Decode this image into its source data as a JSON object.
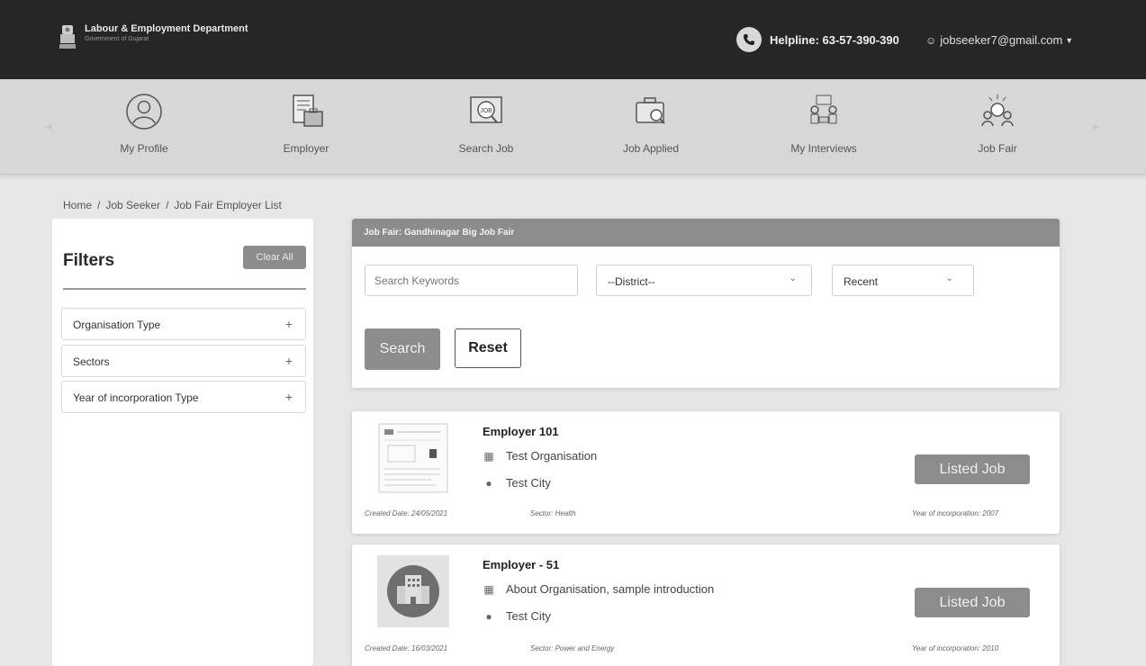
{
  "header": {
    "dept_name": "Labour & Employment Department",
    "dept_sub": "Government of Gujarat",
    "helpline": "Helpline: 63-57-390-390",
    "user_email": "jobseeker7@gmail.com"
  },
  "nav": {
    "items": [
      {
        "label": "My Profile",
        "icon": "profile-icon"
      },
      {
        "label": "Employer",
        "icon": "employer-icon"
      },
      {
        "label": "Search Job",
        "icon": "search-job-icon"
      },
      {
        "label": "Job Applied",
        "icon": "job-applied-icon"
      },
      {
        "label": "My Interviews",
        "icon": "interviews-icon"
      },
      {
        "label": "Job Fair",
        "icon": "job-fair-icon"
      }
    ]
  },
  "breadcrumb": [
    "Home",
    "Job Seeker",
    "Job Fair Employer List"
  ],
  "filters": {
    "title": "Filters",
    "clear_all": "Clear All",
    "items": [
      "Organisation Type",
      "Sectors",
      "Year of incorporation Type"
    ],
    "expand_symbol": "+"
  },
  "search": {
    "header": "Job Fair: Gandhinagar Big Job Fair",
    "keyword_placeholder": "Search Keywords",
    "district_value": "--District--",
    "sort_value": "Recent",
    "search_label": "Search",
    "reset_label": "Reset"
  },
  "employers": [
    {
      "name": "Employer 101",
      "organisation": "Test Organisation",
      "city": "Test City",
      "created": "Created Date: 24/05/2021",
      "sector": "Sector: Health",
      "incorporation": "Year of incorporation: 2007",
      "button": "Listed Job",
      "logo": "document-thumbnail"
    },
    {
      "name": "Employer - 51",
      "organisation": "About Organisation, sample introduction",
      "city": "Test City",
      "created": "Created Date: 16/03/2021",
      "sector": "Sector: Power and Energy",
      "incorporation": "Year of incorporation: 2010",
      "button": "Listed Job",
      "logo": "building-icon"
    }
  ],
  "colors": {
    "topbar": "#262626",
    "navbar": "#d7d7d7",
    "accent_gray": "#8c8c8c",
    "page_bg": "#e6e6e6"
  }
}
